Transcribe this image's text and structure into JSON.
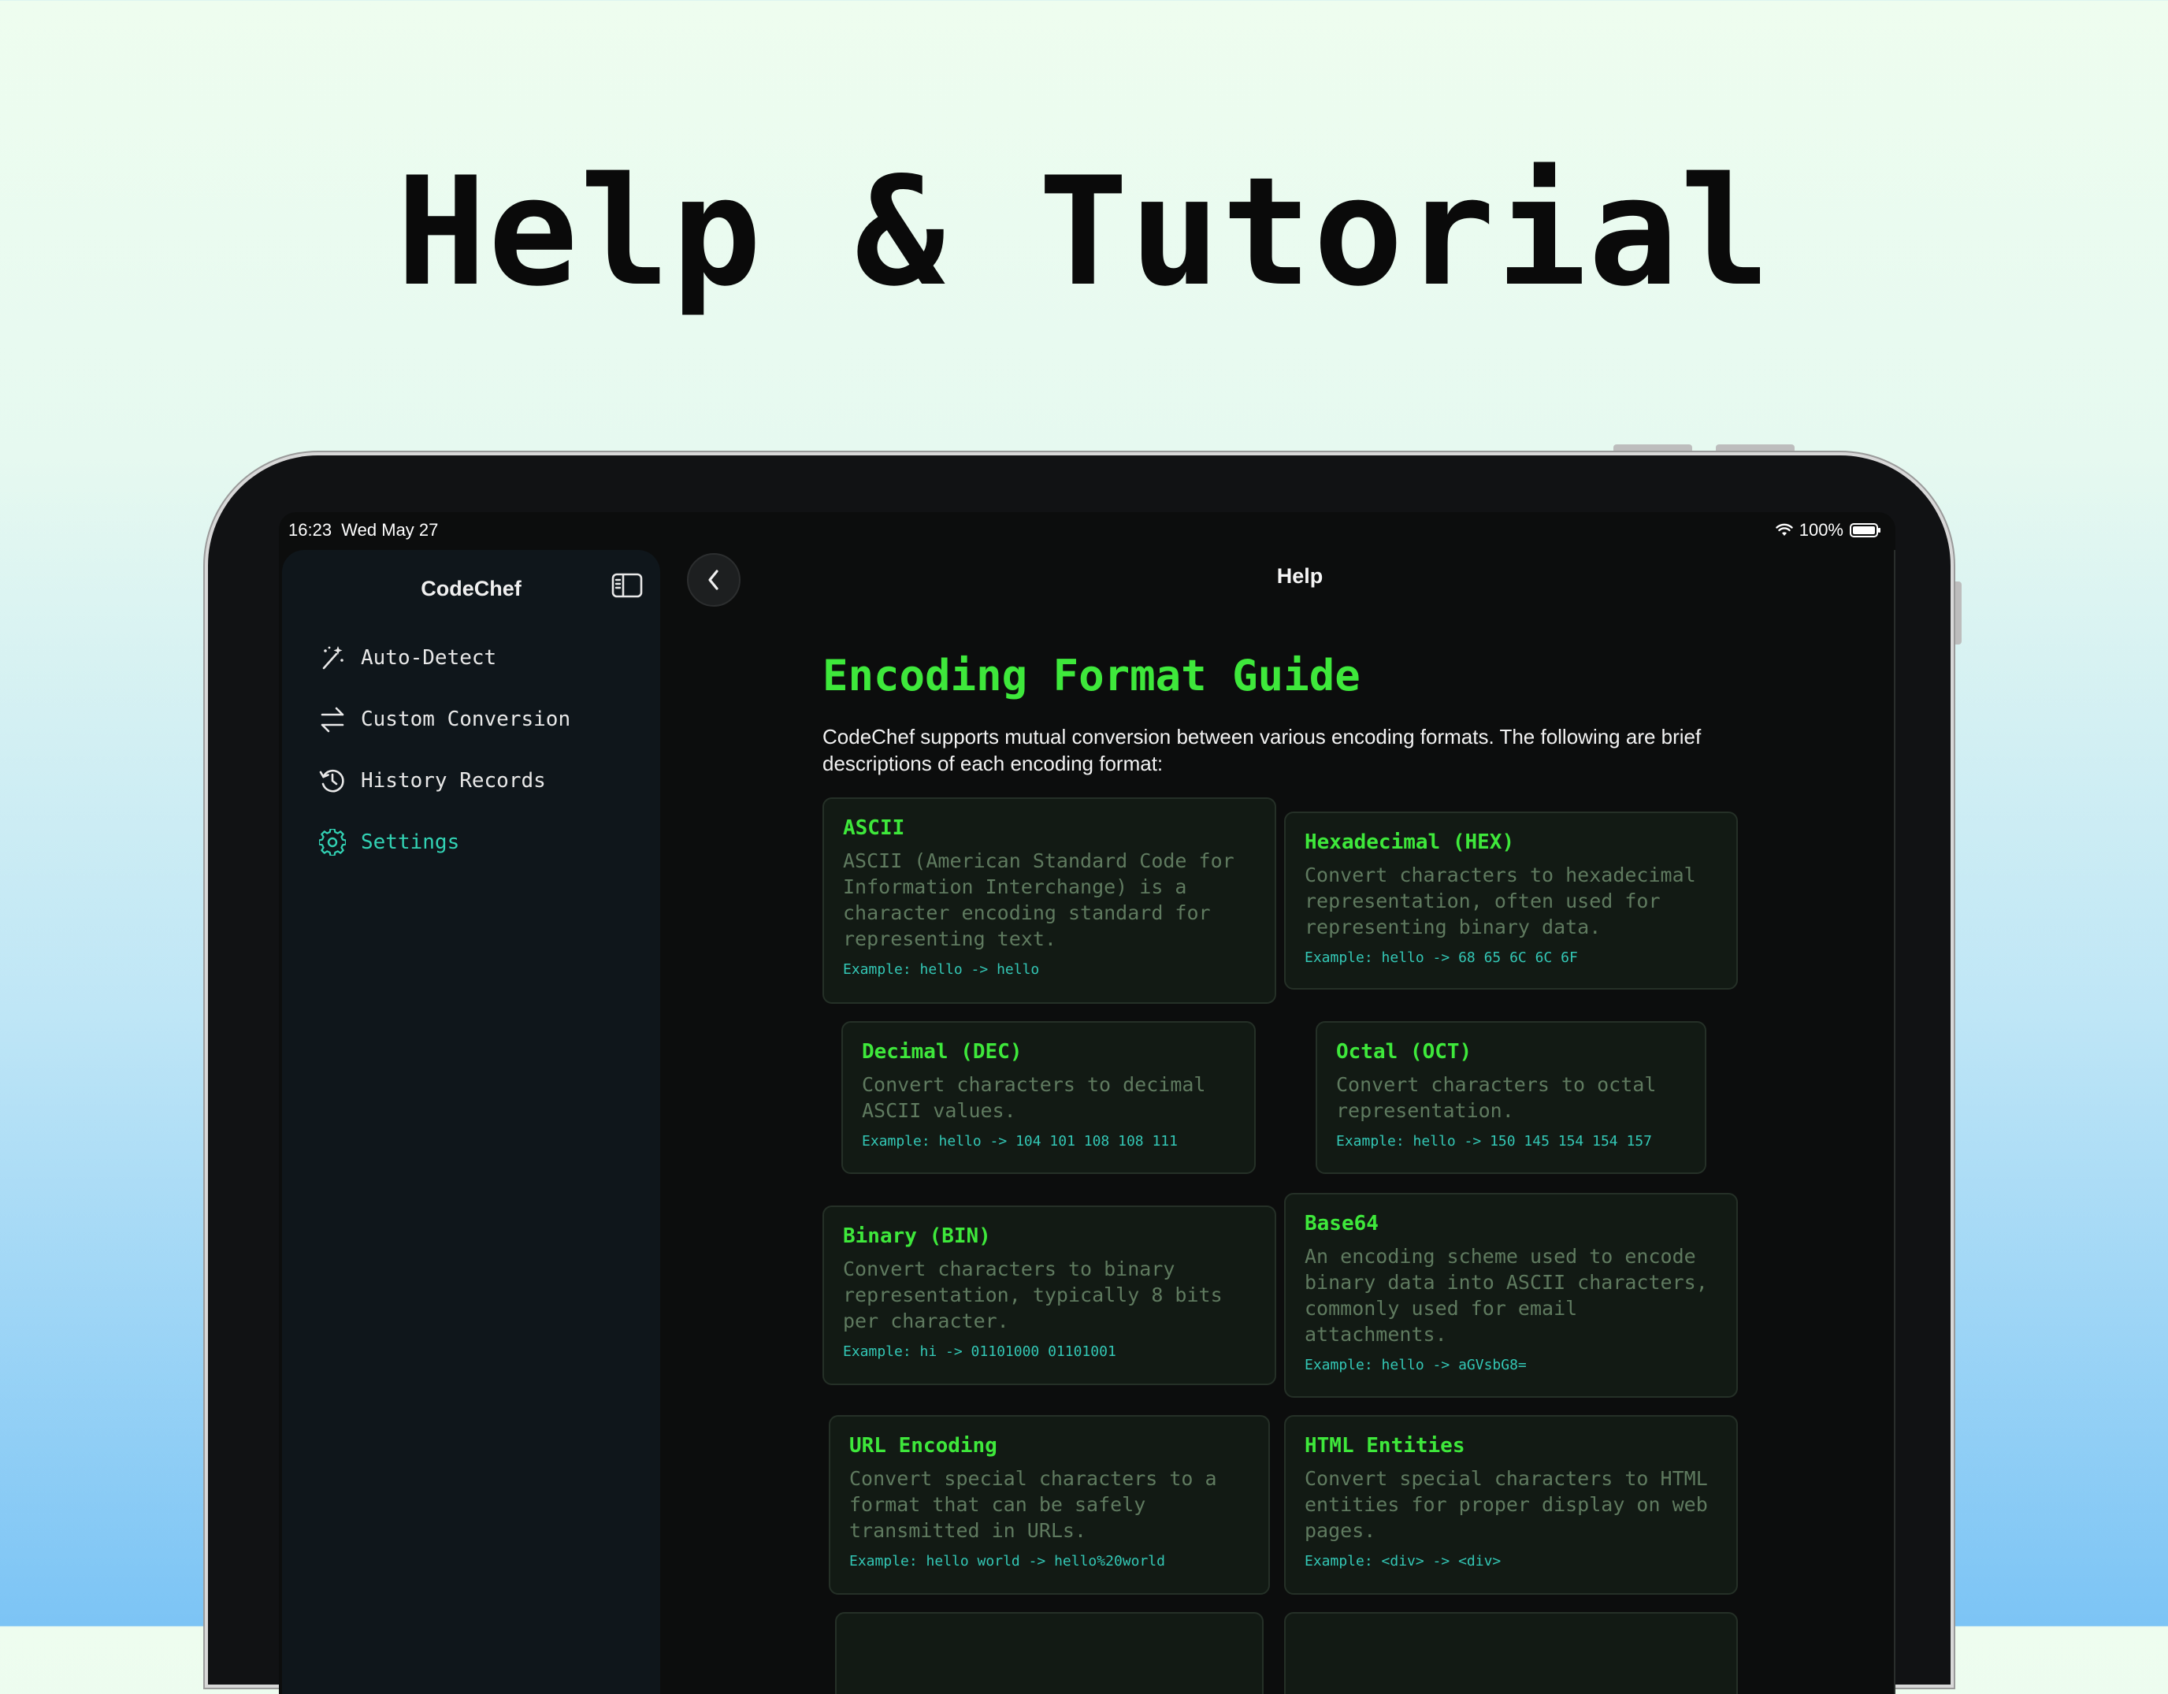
{
  "hero": {
    "title": "Help & Tutorial"
  },
  "status": {
    "time": "16:23",
    "date": "Wed May 27",
    "battery": "100%"
  },
  "sidebar": {
    "title": "CodeChef",
    "items": [
      {
        "label": "Auto-Detect",
        "icon": "magic-wand-icon",
        "active": false
      },
      {
        "label": "Custom Conversion",
        "icon": "arrows-left-right-icon",
        "active": false
      },
      {
        "label": "History Records",
        "icon": "history-clock-icon",
        "active": false
      },
      {
        "label": "Settings",
        "icon": "gear-icon",
        "active": true
      }
    ]
  },
  "nav": {
    "title": "Help"
  },
  "guide": {
    "title": "Encoding Format Guide",
    "intro": "CodeChef supports mutual conversion between various encoding formats. The following are brief descriptions of each encoding format:",
    "cards": [
      {
        "title": "ASCII",
        "desc": "ASCII (American Standard Code for Information Interchange) is a character encoding standard for representing text.",
        "example": "Example: hello -> hello"
      },
      {
        "title": "Hexadecimal (HEX)",
        "desc": "Convert characters to hexadecimal representation, often used for representing binary data.",
        "example": "Example: hello -> 68 65 6C 6C 6F"
      },
      {
        "title": "Decimal (DEC)",
        "desc": "Convert characters to decimal ASCII values.",
        "example": "Example: hello -> 104 101 108 108 111"
      },
      {
        "title": "Octal (OCT)",
        "desc": "Convert characters to octal representation.",
        "example": "Example: hello -> 150 145 154 154 157"
      },
      {
        "title": "Binary (BIN)",
        "desc": "Convert characters to binary representation, typically 8 bits per character.",
        "example": "Example: hi -> 01101000 01101001"
      },
      {
        "title": "Base64",
        "desc": "An encoding scheme used to encode binary data into ASCII characters, commonly used for email attachments.",
        "example": "Example: hello -> aGVsbG8="
      },
      {
        "title": "URL Encoding",
        "desc": "Convert special characters to a format that can be safely transmitted in URLs.",
        "example": "Example: hello world -> hello%20world"
      },
      {
        "title": "HTML Entities",
        "desc": "Convert special characters to HTML entities for proper display on web pages.",
        "example": "Example: <div> -> <div>"
      }
    ]
  },
  "colors": {
    "accent_green": "#3ee83b",
    "accent_teal": "#32d2b4",
    "card_bg": "#121a14",
    "sidebar_bg": "#0f161b"
  }
}
